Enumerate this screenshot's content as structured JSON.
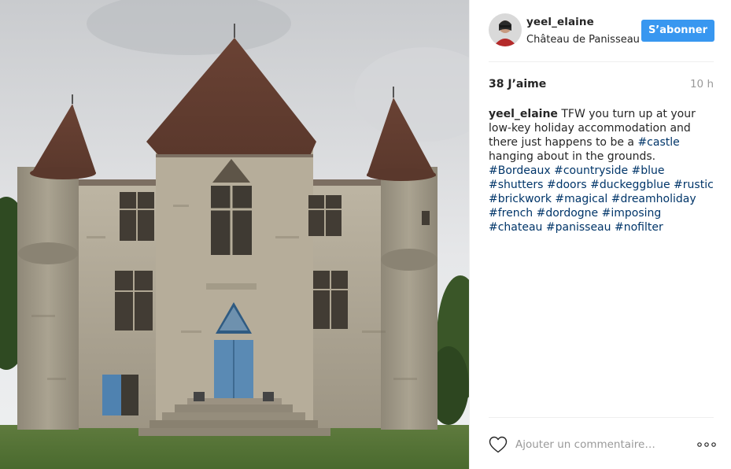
{
  "post": {
    "username": "yeel_elaine",
    "location": "Château de Panisseau",
    "follow_label": "S’abonner",
    "likes": "38 J’aime",
    "timestamp": "10 h",
    "caption": {
      "user": "yeel_elaine",
      "text_before": "TFW you turn up at your low-key holiday accommodation and there just happens to be a",
      "tag_castle": "#castle",
      "text_after": "hanging about in the grounds.",
      "tags": [
        "#Bordeaux",
        "#countryside",
        "#blue",
        "#shutters",
        "#doors",
        "#duckeggblue",
        "#rustic",
        "#brickwork",
        "#magical",
        "#dreamholiday",
        "#french",
        "#dordogne",
        "#imposing",
        "#chateau",
        "#panisseau",
        "#nofilter"
      ]
    },
    "comment_placeholder": "Ajouter un commentaire…"
  },
  "icons": {
    "like": "heart-outline-icon",
    "more": "more-options-icon"
  },
  "colors": {
    "follow_button": "#3897f0",
    "hashtag": "#003569",
    "muted": "#999999",
    "text": "#262626",
    "divider": "#efefef"
  }
}
